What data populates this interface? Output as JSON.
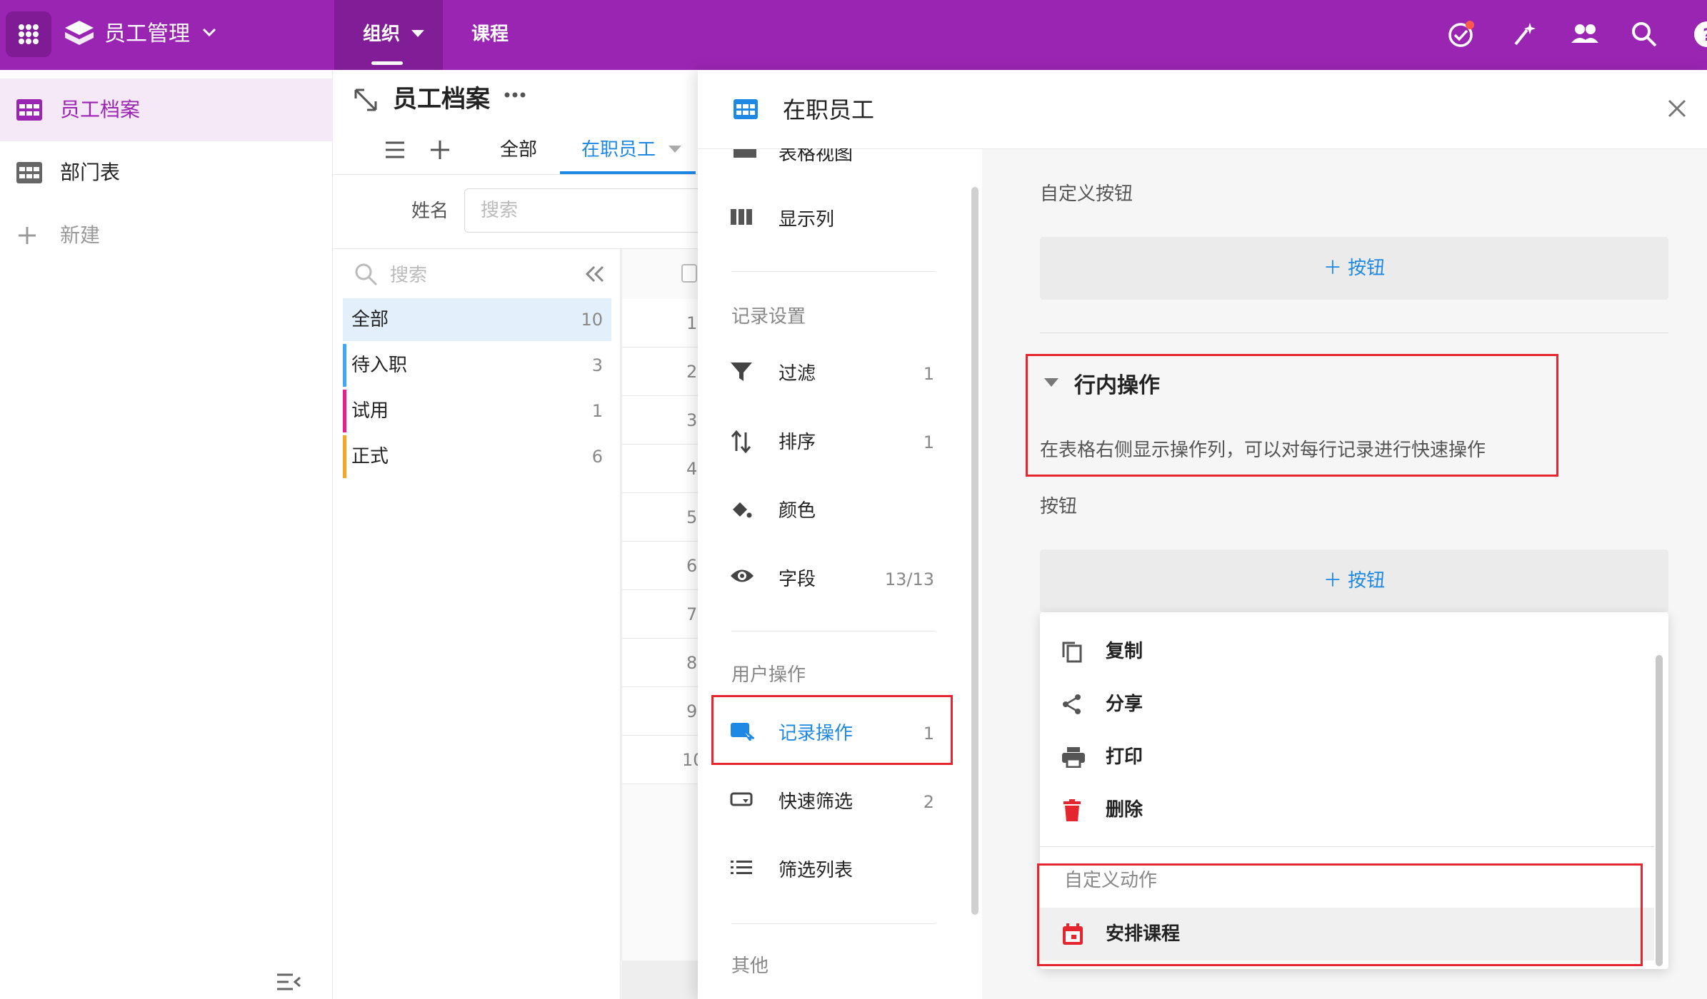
{
  "app": {
    "title": "员工管理",
    "brand_color": "#9b25b3",
    "accent_color": "#1e88e5",
    "alert_color": "#e6262e"
  },
  "topnav": {
    "tabs": [
      {
        "label": "组织",
        "active": true
      },
      {
        "label": "课程",
        "active": false
      }
    ],
    "icons": [
      "todo-check-icon",
      "magic-wand-icon",
      "members-icon",
      "search-icon",
      "help-icon"
    ]
  },
  "sidebar": {
    "items": [
      {
        "label": "员工档案",
        "icon": "table-icon",
        "active": true
      },
      {
        "label": "部门表",
        "icon": "table-icon",
        "active": false
      }
    ],
    "new_label": "新建"
  },
  "view": {
    "title": "员工档案",
    "tabs": [
      {
        "label": "全部"
      },
      {
        "label": "在职员工",
        "active": true
      }
    ],
    "filter_label": "姓名",
    "filter_placeholder": "搜索",
    "group_search_placeholder": "搜索",
    "groups": [
      {
        "label": "全部",
        "count": "10",
        "color": "",
        "active": true
      },
      {
        "label": "待入职",
        "count": "3",
        "color": "#42a5f5"
      },
      {
        "label": "试用",
        "count": "1",
        "color": "#e91e8c"
      },
      {
        "label": "正式",
        "count": "6",
        "color": "#f5a623"
      }
    ],
    "row_numbers": [
      "1",
      "2",
      "3",
      "4",
      "5",
      "6",
      "7",
      "8",
      "9",
      "10"
    ]
  },
  "modal": {
    "title": "在职员工",
    "nav": {
      "partial_item": "表格视图",
      "items_top": [
        {
          "label": "显示列",
          "icon": "columns-icon"
        }
      ],
      "section_record": "记录设置",
      "record_items": [
        {
          "label": "过滤",
          "count": "1",
          "icon": "filter-icon"
        },
        {
          "label": "排序",
          "count": "1",
          "icon": "sort-icon"
        },
        {
          "label": "颜色",
          "count": "",
          "icon": "paint-bucket-icon"
        },
        {
          "label": "字段",
          "count": "13/13",
          "icon": "eye-icon"
        }
      ],
      "section_user": "用户操作",
      "user_items": [
        {
          "label": "记录操作",
          "count": "1",
          "icon": "record-action-icon",
          "selected": true
        },
        {
          "label": "快速筛选",
          "count": "2",
          "icon": "quick-filter-icon"
        },
        {
          "label": "筛选列表",
          "count": "",
          "icon": "list-icon"
        }
      ],
      "section_other": "其他"
    },
    "content": {
      "custom_button_title": "自定义按钮",
      "add_button_label": "按钮",
      "inline_title": "行内操作",
      "inline_desc": "在表格右侧显示操作列，可以对每行记录进行快速操作",
      "buttons_title": "按钮",
      "add_button_label_2": "按钮",
      "dropdown": {
        "items": [
          {
            "label": "复制",
            "icon": "copy-icon"
          },
          {
            "label": "分享",
            "icon": "share-icon"
          },
          {
            "label": "打印",
            "icon": "print-icon"
          },
          {
            "label": "删除",
            "icon": "trash-icon"
          }
        ],
        "section": "自定义动作",
        "custom_items": [
          {
            "label": "安排课程",
            "icon": "calendar-icon"
          }
        ]
      }
    }
  }
}
